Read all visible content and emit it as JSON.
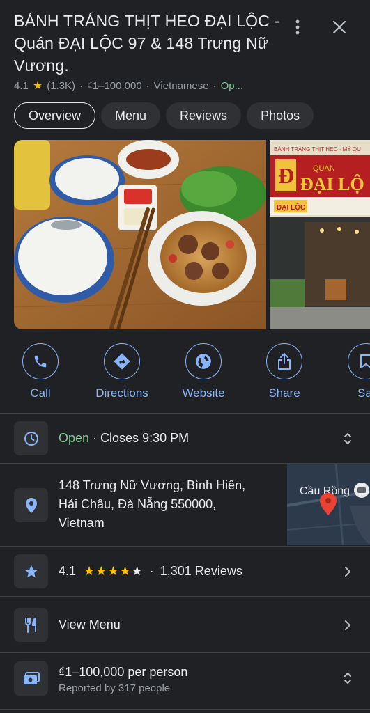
{
  "place": {
    "title": "BÁNH TRÁNG THỊT HEO ĐẠI LỘC - Quán ĐẠI LỘC 97 & 148 Trưng Nữ Vương.",
    "rating": "4.1",
    "rating_count": "(1.3K)",
    "price": "₫1–100,000",
    "cuisine": "Vietnamese",
    "status_short": "Op...",
    "separator": "·"
  },
  "tabs": [
    {
      "label": "Overview",
      "active": true
    },
    {
      "label": "Menu"
    },
    {
      "label": "Reviews"
    },
    {
      "label": "Photos"
    }
  ],
  "photos": {
    "storefront_sign_line1": "BÁNH TRÁNG THỊT HEO · MỸ QU",
    "storefront_sign_quan": "QUÁN",
    "storefront_sign_name": "ĐẠI LỘ",
    "storefront_sign_small": "ĐẠI LỘC",
    "storefront_sign_letter": "Đ"
  },
  "actions": [
    {
      "label": "Call",
      "icon": "phone-icon"
    },
    {
      "label": "Directions",
      "icon": "directions-icon"
    },
    {
      "label": "Website",
      "icon": "globe-icon"
    },
    {
      "label": "Share",
      "icon": "share-icon"
    },
    {
      "label": "Sav",
      "icon": "bookmark-icon"
    }
  ],
  "hours": {
    "status": "Open",
    "separator": " · ",
    "closes": "Closes 9:30 PM"
  },
  "address": {
    "line1": "148 Trưng Nữ Vương, Bình Hiên,",
    "line2": "Hải Châu, Đà Nẵng 550000,",
    "line3": "Vietnam",
    "map_label": "Cầu Rồng"
  },
  "reviews": {
    "rating": "4.1",
    "stars_filled": "★★★★",
    "stars_empty": "★",
    "separator": "·",
    "count": "1,301 Reviews"
  },
  "menu_row": {
    "label": "View Menu"
  },
  "price_row": {
    "label": "₫1–100,000 per person",
    "sub": "Reported by 317 people"
  },
  "colors": {
    "background": "#202124",
    "accent": "#8ab4f8",
    "open": "#81c995",
    "star": "#fbbc04"
  }
}
